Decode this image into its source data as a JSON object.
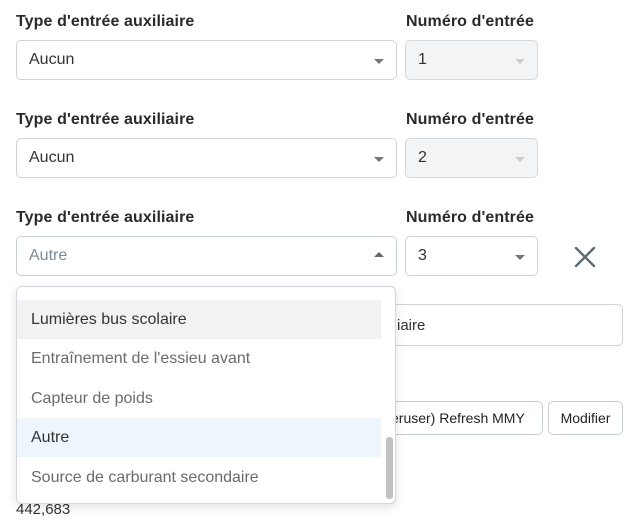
{
  "rows": [
    {
      "type_label": "Type d'entrée auxiliaire",
      "type_value": "Aucun",
      "number_label": "Numéro d'entrée",
      "number_value": "1"
    },
    {
      "type_label": "Type d'entrée auxiliaire",
      "type_value": "Aucun",
      "number_label": "Numéro d'entrée",
      "number_value": "2"
    },
    {
      "type_label": "Type d'entrée auxiliaire",
      "type_value": "Autre",
      "number_label": "Numéro d'entrée",
      "number_value": "3"
    }
  ],
  "dropdown": {
    "options": [
      "Lumières bus scolaire",
      "Entraînement de l'essieu avant",
      "Capteur de poids",
      "Autre",
      "Source de carburant secondaire"
    ],
    "selected": "Autre"
  },
  "background": {
    "input_value_partial": "iaire",
    "refresh_button_partial": "eruser) Refresh MMY",
    "modify_button": "Modifier",
    "bottom_number": "442,683"
  },
  "icons": {
    "remove": "close-icon",
    "caret": "chevron-down-icon"
  },
  "colors": {
    "selected_option_bg": "#eef5fc",
    "hover_option_bg": "#f1f2f4",
    "close_icon": "#5f6b76"
  }
}
